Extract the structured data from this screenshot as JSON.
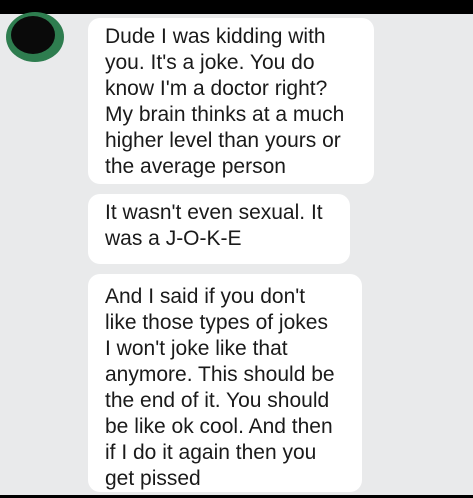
{
  "conversation": {
    "messages": [
      {
        "lines": [
          "Dude I was kidding with",
          "you. It's a joke. You do",
          "know I'm a doctor right?",
          "My brain thinks at a much",
          "higher level than yours or",
          "the average person"
        ]
      },
      {
        "lines": [
          "It wasn't even sexual. It",
          "was a J-O-K-E"
        ]
      },
      {
        "lines": [
          "And I said if you don't",
          "like those types of jokes",
          "I won't joke like that",
          "anymore. This should be",
          "the end of it. You should",
          "be like ok cool. And then",
          "if I do it again then you",
          "get pissed"
        ]
      }
    ]
  },
  "colors": {
    "background": "#e9eaeb",
    "bubble": "#ffffff",
    "text": "#1a1a1a",
    "avatar_ring": "#2e7d4f"
  }
}
